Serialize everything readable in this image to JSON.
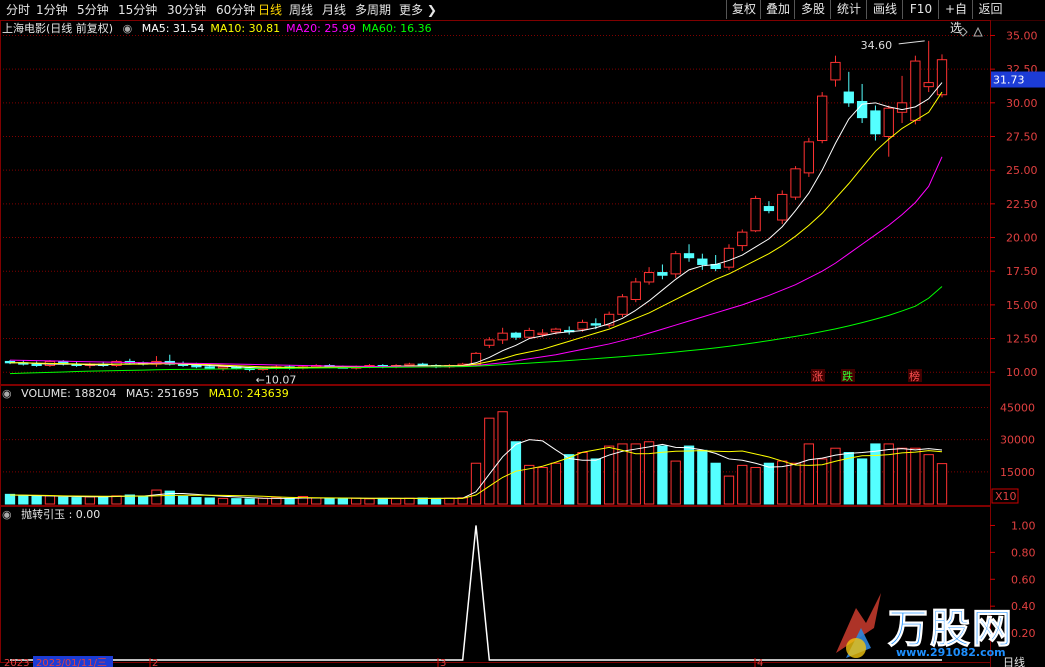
{
  "topbar": {
    "tabs": [
      "分时",
      "1分钟",
      "5分钟",
      "15分钟",
      "30分钟",
      "60分钟",
      "日线",
      "周线",
      "月线",
      "多周期",
      "更多"
    ],
    "active_tab": "日线",
    "buttons": [
      "复权",
      "叠加",
      "多股",
      "统计",
      "画线",
      "F10",
      "+自选",
      "返回"
    ]
  },
  "price_panel": {
    "title": "上海电影(日线 前复权)",
    "ma": [
      {
        "label": "MA5: 31.54",
        "color": "#ffffff"
      },
      {
        "label": "MA10: 30.81",
        "color": "#ffff00"
      },
      {
        "label": "MA20: 25.99",
        "color": "#ff00ff"
      },
      {
        "label": "MA60: 16.36",
        "color": "#00ff00"
      }
    ],
    "ticks": [
      "35.00",
      "32.50",
      "30.00",
      "27.50",
      "25.00",
      "22.50",
      "20.00",
      "17.50",
      "15.00",
      "12.50",
      "10.00"
    ],
    "current_price": "31.73",
    "high_label": "34.60",
    "low_label": "10.07",
    "markers": [
      "涨",
      "跌",
      "榜"
    ]
  },
  "volume_panel": {
    "label": "VOLUME: 188204",
    "ma5": "MA5: 251695",
    "ma10": "MA10: 243639",
    "ticks": [
      "45000",
      "30000",
      "15000"
    ],
    "unit": "X10"
  },
  "indicator_panel": {
    "label": "抛转引玉 : 0.00",
    "ticks": [
      "1.00",
      "0.80",
      "0.60",
      "0.40",
      "0.20"
    ]
  },
  "bottom_axis": {
    "labels": [
      "2023",
      "2023/01/11/三",
      "2",
      "3",
      "4"
    ],
    "right_label": "日线"
  },
  "watermark": {
    "brand": "万股网",
    "url": "www.291082.com"
  },
  "colors": {
    "up": "#ff3232",
    "down": "#54ffff",
    "grid": "#800000",
    "ma5": "#ffffff",
    "ma10": "#ffff00",
    "ma20": "#ff00ff",
    "ma60": "#00ff00"
  },
  "chart_data": [
    {
      "type": "candlestick",
      "ylim": [
        9.2,
        36.0
      ],
      "series": [
        {
          "name": "price",
          "ohlc": [
            [
              10.8,
              10.9,
              10.6,
              10.7
            ],
            [
              10.7,
              10.9,
              10.5,
              10.6
            ],
            [
              10.6,
              10.8,
              10.4,
              10.5
            ],
            [
              10.5,
              10.9,
              10.4,
              10.8
            ],
            [
              10.8,
              10.9,
              10.5,
              10.6
            ],
            [
              10.6,
              10.8,
              10.4,
              10.5
            ],
            [
              10.5,
              10.7,
              10.3,
              10.6
            ],
            [
              10.6,
              10.8,
              10.4,
              10.5
            ],
            [
              10.5,
              10.9,
              10.4,
              10.8
            ],
            [
              10.8,
              11.0,
              10.6,
              10.7
            ],
            [
              10.7,
              10.8,
              10.5,
              10.6
            ],
            [
              10.6,
              11.2,
              10.4,
              10.8
            ],
            [
              10.8,
              11.3,
              10.5,
              10.6
            ],
            [
              10.6,
              10.8,
              10.4,
              10.5
            ],
            [
              10.5,
              10.7,
              10.3,
              10.4
            ],
            [
              10.4,
              10.6,
              10.2,
              10.3
            ],
            [
              10.3,
              10.5,
              10.1,
              10.4
            ],
            [
              10.4,
              10.5,
              10.2,
              10.3
            ],
            [
              10.3,
              10.4,
              10.07,
              10.2
            ],
            [
              10.2,
              10.4,
              10.1,
              10.3
            ],
            [
              10.3,
              10.5,
              10.2,
              10.4
            ],
            [
              10.4,
              10.5,
              10.2,
              10.3
            ],
            [
              10.3,
              10.5,
              10.2,
              10.4
            ],
            [
              10.4,
              10.6,
              10.3,
              10.5
            ],
            [
              10.5,
              10.6,
              10.3,
              10.4
            ],
            [
              10.4,
              10.5,
              10.3,
              10.3
            ],
            [
              10.3,
              10.5,
              10.2,
              10.4
            ],
            [
              10.4,
              10.6,
              10.3,
              10.5
            ],
            [
              10.5,
              10.6,
              10.3,
              10.4
            ],
            [
              10.4,
              10.6,
              10.3,
              10.5
            ],
            [
              10.5,
              10.7,
              10.4,
              10.6
            ],
            [
              10.6,
              10.7,
              10.4,
              10.5
            ],
            [
              10.5,
              10.6,
              10.3,
              10.4
            ],
            [
              10.4,
              10.6,
              10.3,
              10.5
            ],
            [
              10.5,
              10.7,
              10.4,
              10.6
            ],
            [
              10.6,
              11.5,
              10.5,
              11.4
            ],
            [
              12.0,
              12.6,
              11.8,
              12.4
            ],
            [
              12.4,
              13.3,
              12.1,
              12.9
            ],
            [
              12.9,
              13.0,
              12.4,
              12.6
            ],
            [
              12.6,
              13.3,
              12.5,
              13.1
            ],
            [
              12.8,
              13.2,
              12.6,
              12.9
            ],
            [
              13.0,
              13.3,
              12.8,
              13.2
            ],
            [
              13.1,
              13.4,
              12.8,
              13.0
            ],
            [
              13.2,
              13.9,
              13.0,
              13.7
            ],
            [
              13.6,
              14.0,
              13.2,
              13.5
            ],
            [
              13.5,
              14.5,
              13.3,
              14.3
            ],
            [
              14.3,
              15.8,
              14.1,
              15.6
            ],
            [
              15.4,
              17.0,
              15.2,
              16.7
            ],
            [
              16.7,
              17.8,
              16.5,
              17.4
            ],
            [
              17.4,
              18.0,
              16.9,
              17.2
            ],
            [
              17.3,
              19.0,
              17.0,
              18.8
            ],
            [
              18.8,
              19.5,
              18.2,
              18.5
            ],
            [
              18.4,
              18.8,
              17.6,
              18.0
            ],
            [
              18.0,
              18.7,
              17.5,
              17.7
            ],
            [
              17.8,
              19.5,
              17.6,
              19.2
            ],
            [
              19.4,
              20.6,
              19.0,
              20.4
            ],
            [
              20.5,
              23.1,
              20.4,
              22.9
            ],
            [
              22.3,
              22.7,
              21.8,
              22.0
            ],
            [
              21.3,
              23.5,
              21.0,
              23.2
            ],
            [
              23.0,
              25.3,
              22.8,
              25.1
            ],
            [
              24.8,
              27.4,
              24.5,
              27.1
            ],
            [
              27.2,
              30.8,
              27.0,
              30.5
            ],
            [
              31.7,
              33.5,
              31.2,
              33.0
            ],
            [
              30.8,
              32.3,
              29.7,
              30.0
            ],
            [
              30.1,
              31.4,
              28.5,
              28.9
            ],
            [
              29.4,
              29.8,
              27.2,
              27.7
            ],
            [
              27.5,
              29.8,
              26.0,
              29.6
            ],
            [
              29.3,
              32.0,
              28.5,
              30.0
            ],
            [
              28.7,
              33.5,
              28.4,
              33.1
            ],
            [
              31.2,
              34.6,
              30.8,
              31.5
            ],
            [
              30.6,
              33.6,
              30.4,
              33.2
            ]
          ]
        },
        {
          "name": "MA5",
          "values": [
            10.7,
            10.7,
            10.65,
            10.6,
            10.6,
            10.6,
            10.55,
            10.55,
            10.6,
            10.6,
            10.65,
            10.7,
            10.7,
            10.6,
            10.55,
            10.5,
            10.45,
            10.4,
            10.35,
            10.3,
            10.3,
            10.3,
            10.32,
            10.35,
            10.38,
            10.38,
            10.4,
            10.4,
            10.42,
            10.44,
            10.46,
            10.48,
            10.48,
            10.48,
            10.5,
            10.7,
            11.1,
            11.6,
            12.0,
            12.5,
            12.7,
            12.9,
            13.0,
            13.1,
            13.3,
            13.6,
            14.0,
            14.6,
            15.3,
            16.1,
            16.9,
            17.6,
            17.9,
            18.0,
            18.3,
            18.7,
            19.3,
            19.9,
            20.8,
            22.0,
            23.3,
            25.0,
            27.0,
            28.8,
            29.9,
            30.0,
            29.7,
            29.5,
            29.7,
            30.3,
            31.5
          ]
        },
        {
          "name": "MA10",
          "values": [
            10.7,
            10.7,
            10.68,
            10.66,
            10.64,
            10.62,
            10.6,
            10.6,
            10.6,
            10.6,
            10.6,
            10.62,
            10.64,
            10.62,
            10.6,
            10.56,
            10.52,
            10.48,
            10.44,
            10.4,
            10.38,
            10.36,
            10.36,
            10.36,
            10.37,
            10.38,
            10.39,
            10.4,
            10.41,
            10.42,
            10.43,
            10.44,
            10.45,
            10.46,
            10.47,
            10.6,
            10.8,
            11.0,
            11.3,
            11.5,
            11.7,
            12.0,
            12.3,
            12.6,
            12.9,
            13.2,
            13.6,
            14.0,
            14.4,
            14.9,
            15.4,
            15.9,
            16.4,
            16.9,
            17.3,
            17.8,
            18.3,
            18.8,
            19.4,
            20.1,
            20.9,
            21.8,
            22.9,
            24.0,
            25.2,
            26.4,
            27.3,
            28.1,
            28.7,
            29.3,
            30.8
          ]
        },
        {
          "name": "MA20",
          "values": [
            10.9,
            10.88,
            10.86,
            10.84,
            10.82,
            10.8,
            10.78,
            10.76,
            10.74,
            10.72,
            10.7,
            10.69,
            10.68,
            10.67,
            10.66,
            10.64,
            10.62,
            10.6,
            10.58,
            10.56,
            10.54,
            10.52,
            10.5,
            10.48,
            10.46,
            10.45,
            10.44,
            10.43,
            10.42,
            10.42,
            10.42,
            10.42,
            10.42,
            10.42,
            10.43,
            10.5,
            10.6,
            10.7,
            10.85,
            11.0,
            11.15,
            11.3,
            11.5,
            11.7,
            11.9,
            12.1,
            12.35,
            12.6,
            12.9,
            13.2,
            13.5,
            13.8,
            14.1,
            14.4,
            14.7,
            15.0,
            15.35,
            15.7,
            16.1,
            16.5,
            17.0,
            17.5,
            18.1,
            18.8,
            19.5,
            20.2,
            20.9,
            21.7,
            22.6,
            23.8,
            25.99
          ]
        },
        {
          "name": "MA60",
          "values": [
            9.9,
            9.93,
            9.96,
            9.99,
            10.02,
            10.05,
            10.08,
            10.1,
            10.12,
            10.14,
            10.16,
            10.18,
            10.2,
            10.21,
            10.22,
            10.23,
            10.24,
            10.25,
            10.26,
            10.27,
            10.28,
            10.29,
            10.3,
            10.31,
            10.32,
            10.33,
            10.34,
            10.35,
            10.36,
            10.37,
            10.38,
            10.39,
            10.4,
            10.41,
            10.42,
            10.45,
            10.5,
            10.56,
            10.62,
            10.68,
            10.74,
            10.8,
            10.87,
            10.94,
            11.01,
            11.08,
            11.16,
            11.24,
            11.32,
            11.41,
            11.5,
            11.6,
            11.7,
            11.81,
            11.93,
            12.06,
            12.2,
            12.35,
            12.5,
            12.66,
            12.83,
            13.02,
            13.22,
            13.44,
            13.68,
            13.94,
            14.22,
            14.55,
            14.9,
            15.5,
            16.36
          ]
        }
      ]
    },
    {
      "type": "bar",
      "name": "VOLUME",
      "ylim": [
        0,
        48000
      ],
      "values": [
        4500,
        4000,
        3500,
        3800,
        3200,
        3000,
        3300,
        3500,
        3800,
        4200,
        3700,
        6500,
        6000,
        3500,
        3000,
        2800,
        2600,
        2500,
        2400,
        2700,
        2900,
        2600,
        3500,
        2800,
        2500,
        2600,
        2700,
        2400,
        2600,
        2500,
        2700,
        2800,
        2600,
        2700,
        2900,
        19000,
        40000,
        43000,
        29000,
        18000,
        17000,
        19000,
        23000,
        24000,
        21000,
        27000,
        28000,
        28000,
        29000,
        27000,
        20000,
        27000,
        25000,
        19000,
        13000,
        18000,
        17000,
        19000,
        20000,
        19000,
        28000,
        21000,
        26000,
        24000,
        21000,
        28000,
        28000,
        26000,
        26000,
        23000,
        18820
      ],
      "ma5": [
        4200,
        4100,
        3900,
        3800,
        3600,
        3500,
        3400,
        3400,
        3500,
        3700,
        3700,
        4300,
        4900,
        4900,
        4500,
        4000,
        3600,
        3300,
        3000,
        2700,
        2600,
        2600,
        2800,
        2800,
        2800,
        2800,
        2700,
        2600,
        2600,
        2600,
        2600,
        2600,
        2600,
        2700,
        2700,
        5700,
        13900,
        22000,
        27800,
        30000,
        29400,
        25200,
        21200,
        20400,
        20400,
        22800,
        24600,
        25600,
        26600,
        27800,
        26400,
        26200,
        25200,
        23600,
        21000,
        20400,
        19000,
        17200,
        17400,
        18600,
        20600,
        21400,
        22800,
        23600,
        24000,
        24600,
        25400,
        25800,
        25200,
        25800,
        25169
      ],
      "ma10": [
        4200,
        4150,
        4050,
        3950,
        3800,
        3700,
        3650,
        3600,
        3600,
        3650,
        3650,
        3800,
        4000,
        4100,
        4100,
        4050,
        4000,
        3900,
        3800,
        3600,
        3300,
        3100,
        3000,
        2900,
        2850,
        2800,
        2750,
        2700,
        2700,
        2700,
        2650,
        2650,
        2650,
        2650,
        2650,
        4200,
        8300,
        12400,
        15300,
        16400,
        17600,
        19500,
        21600,
        24100,
        25200,
        26400,
        25000,
        23400,
        23500,
        24100,
        24600,
        24700,
        24900,
        24600,
        24400,
        24700,
        23300,
        21900,
        20000,
        18200,
        18000,
        18300,
        19900,
        21300,
        22500,
        22600,
        23000,
        23800,
        24200,
        24900,
        24364
      ]
    },
    {
      "type": "line",
      "name": "抛转引玉",
      "ylim": [
        0,
        1.1
      ],
      "values": [
        0,
        0,
        0,
        0,
        0,
        0,
        0,
        0,
        0,
        0,
        0,
        0,
        0,
        0,
        0,
        0,
        0,
        0,
        0,
        0,
        0,
        0,
        0,
        0,
        0,
        0,
        0,
        0,
        0,
        0,
        0,
        0,
        0,
        0,
        0,
        1.0,
        0,
        0,
        0,
        0,
        0,
        0,
        0,
        0,
        0,
        0,
        0,
        0,
        0,
        0,
        0,
        0,
        0,
        0,
        0,
        0,
        0,
        0,
        0,
        0,
        0,
        0,
        0,
        0,
        0,
        0,
        0,
        0,
        0,
        0,
        0
      ]
    }
  ]
}
